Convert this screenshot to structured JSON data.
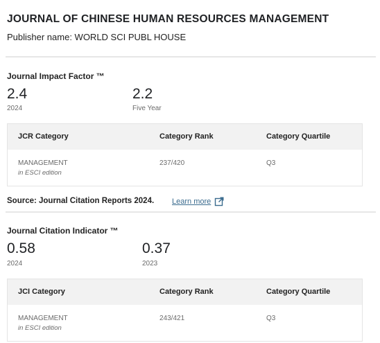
{
  "journal": {
    "title": "JOURNAL OF CHINESE HUMAN RESOURCES MANAGEMENT",
    "publisher": "Publisher name: WORLD SCI PUBL HOUSE"
  },
  "impact_factor": {
    "heading": "Journal Impact Factor ™",
    "metrics": [
      {
        "value": "2.4",
        "label": "2024"
      },
      {
        "value": "2.2",
        "label": "Five Year"
      }
    ],
    "table": {
      "headers": [
        "JCR Category",
        "Category Rank",
        "Category Quartile"
      ],
      "rows": [
        {
          "category": "MANAGEMENT",
          "edition": "in ESCI edition",
          "rank": "237/420",
          "quartile": "Q3"
        }
      ]
    }
  },
  "source": {
    "text": "Source: Journal Citation Reports 2024.",
    "link_label": "Learn more",
    "link_icon": "external-link-icon",
    "link_color": "#3a6b8e"
  },
  "citation_indicator": {
    "heading": "Journal Citation Indicator ™",
    "metrics": [
      {
        "value": "0.58",
        "label": "2024"
      },
      {
        "value": "0.37",
        "label": "2023"
      }
    ],
    "table": {
      "headers": [
        "JCI Category",
        "Category Rank",
        "Category Quartile"
      ],
      "rows": [
        {
          "category": "MANAGEMENT",
          "edition": "in ESCI edition",
          "rank": "243/421",
          "quartile": "Q3"
        }
      ]
    }
  }
}
